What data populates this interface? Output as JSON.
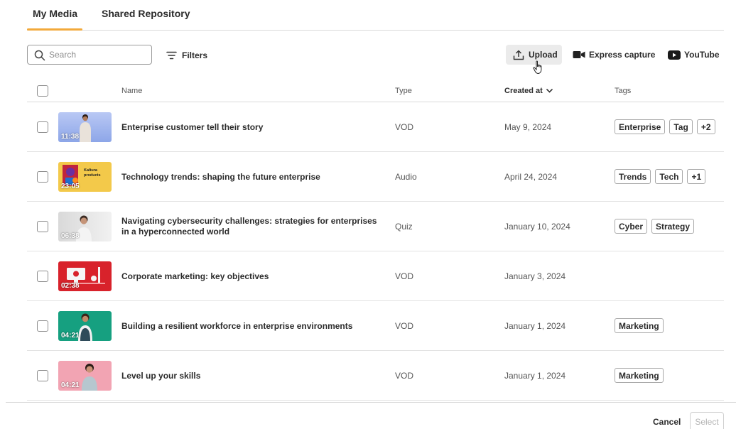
{
  "tabs": [
    {
      "label": "My Media",
      "active": true
    },
    {
      "label": "Shared Repository",
      "active": false
    }
  ],
  "colors": {
    "accent": "#f2a93b"
  },
  "toolbar": {
    "search_placeholder": "Search",
    "filters_label": "Filters",
    "upload_label": "Upload",
    "express_label": "Express capture",
    "youtube_label": "YouTube"
  },
  "table": {
    "headers": {
      "name": "Name",
      "type": "Type",
      "created": "Created at",
      "tags": "Tags"
    },
    "rows": [
      {
        "duration": "11:38",
        "name": "Enterprise customer tell their story",
        "type": "VOD",
        "date": "May 9, 2024",
        "tags": [
          "Enterprise",
          "Tag",
          "+2"
        ]
      },
      {
        "duration": "23:05",
        "name": "Technology trends: shaping the future enterprise",
        "type": "Audio",
        "date": "April 24, 2024",
        "tags": [
          "Trends",
          "Tech",
          "+1"
        ],
        "thumb_text": "Kaltura products"
      },
      {
        "duration": "06:38",
        "name": "Navigating cybersecurity challenges: strategies for enterprises in a hyperconnected world",
        "type": "Quiz",
        "date": "January 10, 2024",
        "tags": [
          "Cyber",
          "Strategy"
        ]
      },
      {
        "duration": "02:38",
        "name": "Corporate marketing: key objectives",
        "type": "VOD",
        "date": "January 3, 2024",
        "tags": []
      },
      {
        "duration": "04:21",
        "name": "Building a resilient workforce in enterprise environments",
        "type": "VOD",
        "date": "January 1, 2024",
        "tags": [
          "Marketing"
        ]
      },
      {
        "duration": "04:21",
        "name": "Level up your skills",
        "type": "VOD",
        "date": "January 1, 2024",
        "tags": [
          "Marketing"
        ]
      }
    ]
  },
  "footer": {
    "cancel_label": "Cancel",
    "select_label": "Select"
  }
}
